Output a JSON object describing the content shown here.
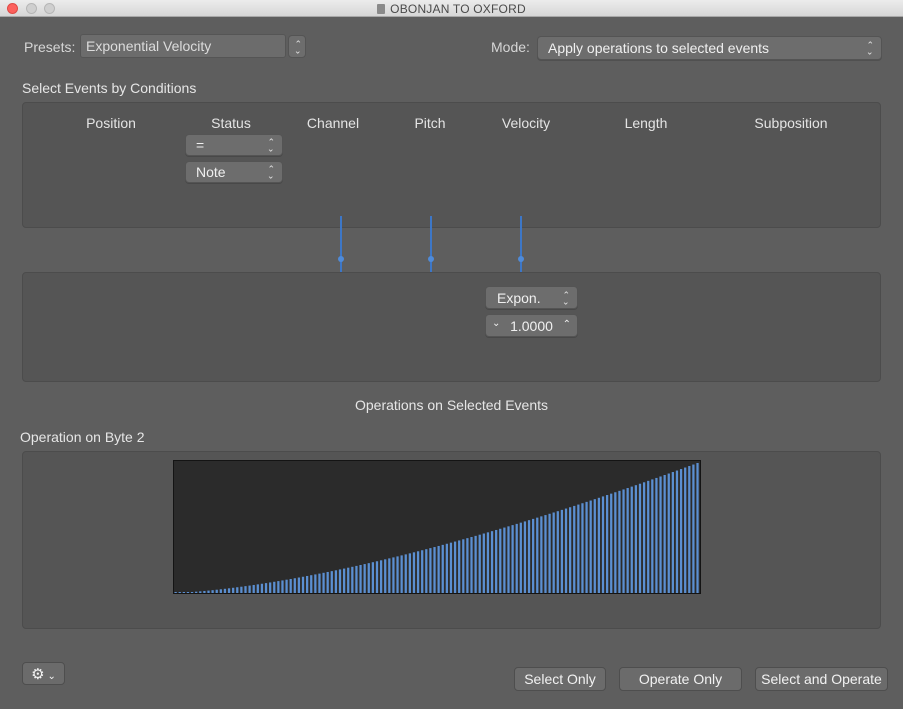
{
  "window": {
    "title": "OBONJAN TO OXFORD"
  },
  "presets": {
    "label": "Presets:",
    "value": "Exponential Velocity"
  },
  "mode": {
    "label": "Mode:",
    "value": "Apply operations to selected events"
  },
  "conditions": {
    "title": "Select Events by Conditions",
    "columns": [
      "Position",
      "Status",
      "Channel",
      "Pitch",
      "Velocity",
      "Length",
      "Subposition"
    ],
    "status_operator": "=",
    "status_value": "Note"
  },
  "operations": {
    "velocity_operation": "Expon.",
    "velocity_value": "1.0000",
    "title": "Operations on Selected Events"
  },
  "byte2": {
    "title": "Operation on Byte 2",
    "curve_exponent_hint": 1.0,
    "bar_color": "#5b8fd1"
  },
  "buttons": {
    "select_only": "Select Only",
    "operate_only": "Operate Only",
    "select_and_operate": "Select and Operate"
  }
}
